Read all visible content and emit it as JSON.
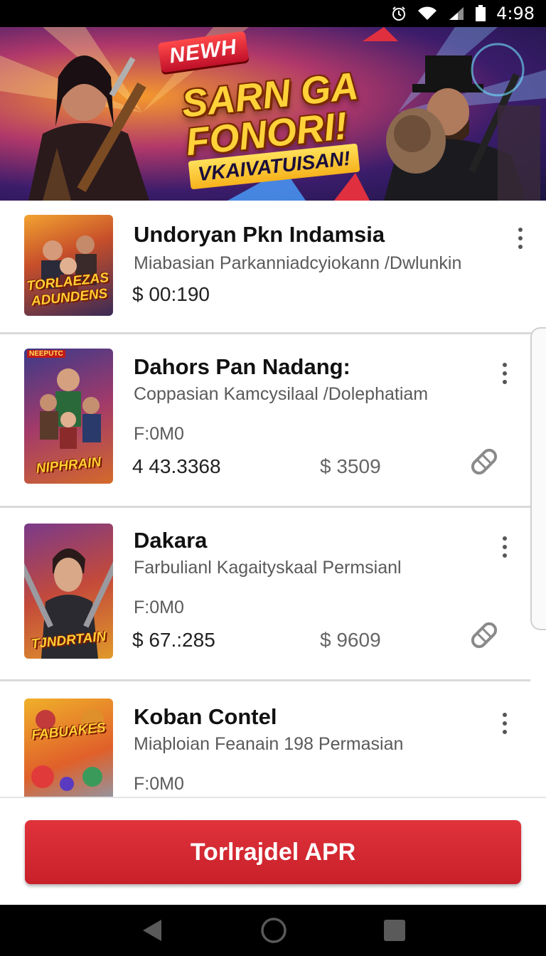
{
  "status_bar": {
    "time": "4:98",
    "icons": [
      "alarm-icon",
      "wifi-icon",
      "signal-icon",
      "battery-icon"
    ]
  },
  "banner": {
    "badge": "NEWH",
    "headline_line1": "SARN GA",
    "headline_line2": "FONORI!",
    "subline": "VKAIVATUISAN!"
  },
  "items": [
    {
      "title": "Undoryan Pkn Indamsia",
      "subtitle": "Miabasian Parkanniadcyiokann /Dwlunkin",
      "price": "$ 00:190",
      "thumb_text": "TORLAEZAS ADUNDENS",
      "thumb_corner": ""
    },
    {
      "title": "Dahors Pan Nadang:",
      "subtitle": "Coppasian Kamcysilaal /Dolephatiam",
      "meta": "F:0M0",
      "value": "4 43.3368",
      "price": "$ 3509",
      "thumb_text": "NIPHRAIN",
      "thumb_corner": "NEEPUTC"
    },
    {
      "title": "Dakara",
      "subtitle": "Farbulianl Kagaityskaal Permsianl",
      "meta": "F:0M0",
      "value": "$ 67.:285",
      "price": "$ 9609",
      "thumb_text": "TJNDRTAIN",
      "thumb_corner": ""
    },
    {
      "title": "Koban Contel",
      "subtitle": "Miaþloian Feanain 198 Permasian",
      "meta": "F:0M0",
      "thumb_text": "FABUAKES",
      "thumb_corner": ""
    }
  ],
  "action": {
    "label": "Torlrajdel APR"
  },
  "colors": {
    "accent": "#d42a32",
    "text": "#111111",
    "muted": "#5a5a5a"
  }
}
